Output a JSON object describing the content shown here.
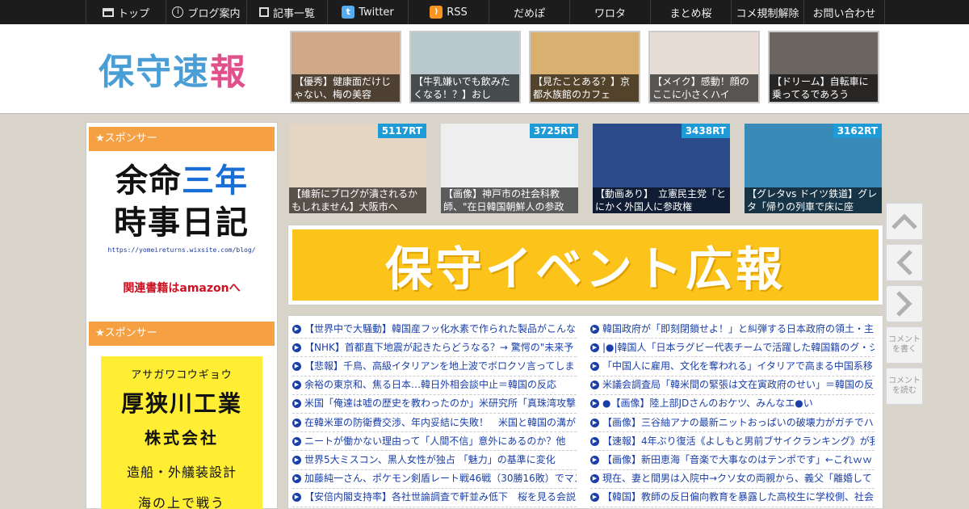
{
  "nav": [
    {
      "label": "トップ",
      "icon": "home-icon",
      "w": 100
    },
    {
      "label": "ブログ案内",
      "icon": "info-icon",
      "w": 100
    },
    {
      "label": "記事一覧",
      "icon": "list-icon",
      "w": 100
    },
    {
      "label": "Twitter",
      "icon": "twitter-icon",
      "w": 100
    },
    {
      "label": "RSS",
      "icon": "rss-icon",
      "w": 100
    },
    {
      "label": "だめぽ",
      "icon": "",
      "w": 100
    },
    {
      "label": "ワロタ",
      "icon": "",
      "w": 100
    },
    {
      "label": "まとめ桜",
      "icon": "",
      "w": 100
    },
    {
      "label": "コメ規制解除",
      "icon": "",
      "w": 90
    },
    {
      "label": "お問い合わせ",
      "icon": "",
      "w": 100
    }
  ],
  "logo": {
    "part1": "保守",
    "part2": "速",
    "part3": "報"
  },
  "header_thumbs": [
    {
      "caption": "【優秀】健康面だけじゃない、梅の美容",
      "bg": "#cfa88a"
    },
    {
      "caption": "【牛乳嫌いでも飲みたくなる！？】おし",
      "bg": "#b8c8cc"
    },
    {
      "caption": "【見たことある？】京都水族館のカフェ",
      "bg": "#d9b070"
    },
    {
      "caption": "【メイク】感動！顔のここに小さくハイ",
      "bg": "#e8ddd6"
    },
    {
      "caption": "【ドリーム】自転車に乗ってるであろう",
      "bg": "#6a6560"
    }
  ],
  "sidebar": {
    "sponsor_label": "★スポンサー",
    "ad1": {
      "line1a": "余命",
      "line1b": "三年",
      "line2": "時事日記",
      "url": "https://yomeireturns.wixsite.com/blog/",
      "amazon": "関連書籍はamazonへ"
    },
    "ad2": {
      "kana": "アサガワコウギョウ",
      "name": "厚狭川工業",
      "kk": "株式会社",
      "biz": "造船・外艤装設計",
      "more": "海の上で戦う"
    }
  },
  "ranking": [
    {
      "rt": "5117RT",
      "caption": "【維新にブログが潰されるかもしれません】大阪市へ",
      "bg": "#e4d6c2"
    },
    {
      "rt": "3725RT",
      "caption": "【画像】神戸市の社会科教師、\"在日韓国朝鮮人の参政",
      "bg": "#eeeeee"
    },
    {
      "rt": "3438RT",
      "caption": "【動画あり】　立憲民主党「とにかく外国人に参政権",
      "bg": "#2a4a8a"
    },
    {
      "rt": "3162RT",
      "caption": "【グレタvs ドイツ鉄道】グレタ「帰りの列車で床に座",
      "bg": "#3a8ab8"
    }
  ],
  "banner": {
    "text": "保守イベント広報"
  },
  "links_left": [
    "【世界中で大騒動】韓国産フッ化水素で作られた製品がこんな",
    "【NHK】首都直下地震が起きたらどうなる？→ 驚愕の\"未来予",
    "【悲報】千鳥、高級イタリアンを地上波でボロクソ言ってしま",
    "余裕の東京和、焦る日本…韓日外相会談中止＝韓国の反応",
    "米国「俺達は嘘の歴史を教わったのか」米研究所「真珠湾攻撃",
    "在韓米軍の防衛費交渉、年内妥結に失敗！　米国と韓国の溝が",
    "ニートが働かない理由って「人間不信」意外にあるのか？他",
    "世界5大ミスコン、黒人女性が独占 「魅力」の基準に変化",
    "加藤純一さん、ポケモン剣盾レート戦46戦（30勝16敗）でマス",
    "【安倍内閣支持率】各社世論調査で軒並み低下　桜を見る会説"
  ],
  "links_right": [
    "韓国政府が「即刻閉鎖せよ！」と糾弾する日本政府の領土・主",
    "|●|韓国人「日本ラグビー代表チームで活躍した韓国籍のグ・ジ",
    "「中国人に雇用、文化を奪われる」イタリアで高まる中国系移",
    "米議会調査局「韓米間の緊張は文在寅政府のせい」＝韓国の反",
    "●【画像】陸上部JDさんのおケツ、みんなエ●い",
    "【画像】三谷紬アナの最新ニットおっぱいの破壊力がガチでハン",
    "【速報】4年ぶり復活《よしもと男前ブサイクランキング》が我",
    "【画像】新田恵海「音楽で大事なのはテンポです」←これｗｗ",
    "現在、妻と間男は入院中→クソ女の両親から、義父「離婚して",
    "【韓国】教師の反日偏向教育を暴露した高校生に学校側、社会"
  ],
  "float_buttons": {
    "write": "コメントを書く",
    "read": "コメントを読む"
  }
}
